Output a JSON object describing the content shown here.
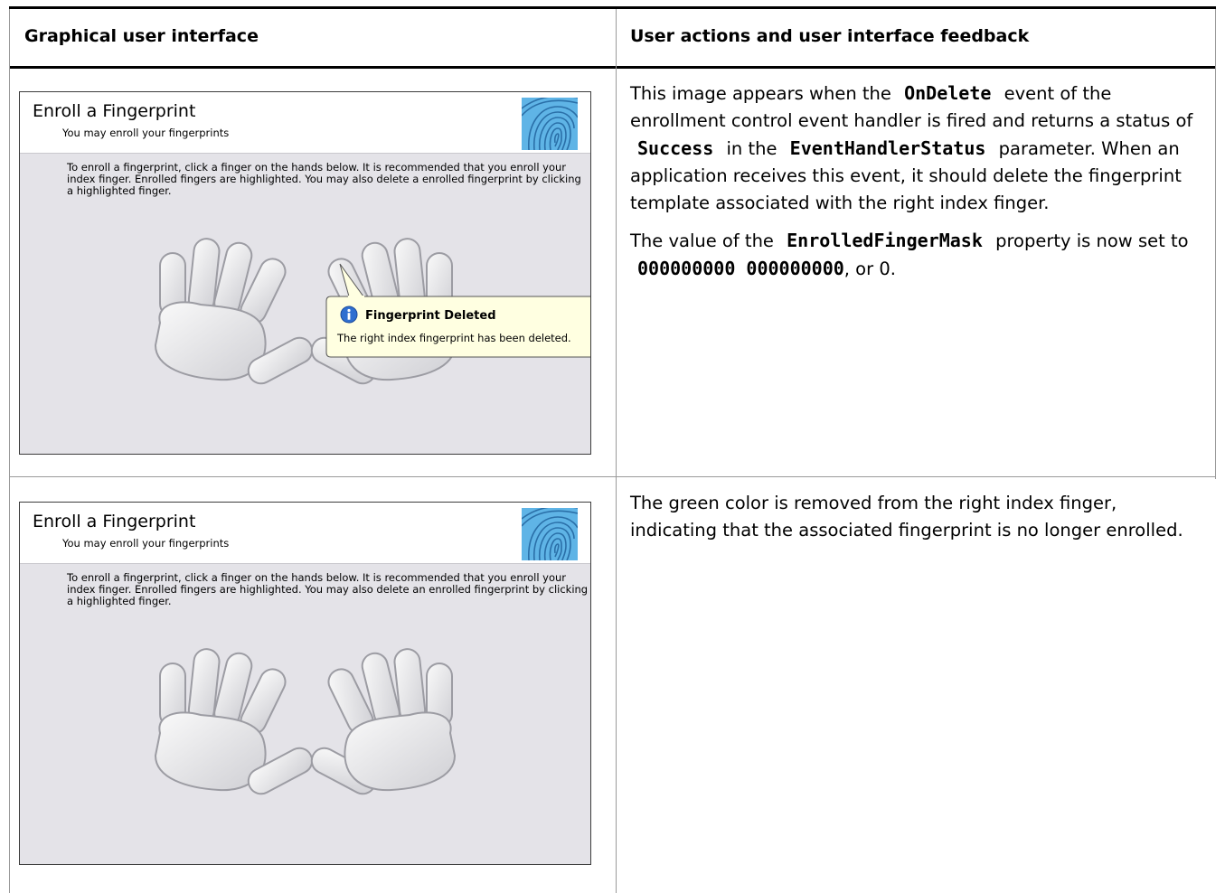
{
  "table": {
    "header_left": "Graphical user interface",
    "header_right": "User actions and user interface feedback"
  },
  "rows": [
    {
      "screenshot": {
        "title": "Enroll a Fingerprint",
        "subtitle": "You may enroll your fingerprints",
        "instructions": "To enroll a fingerprint, click a finger on the hands below. It is recommended that you enroll your index finger. Enrolled fingers are highlighted. You may also delete a enrolled fingerprint by clicking a highlighted finger.",
        "balloon_title": "Fingerprint Deleted",
        "balloon_text": "The right index fingerprint has been deleted.",
        "balloon_icon": "info-icon"
      },
      "feedback": {
        "p1_a": "This image appears when the",
        "p1_code1": "OnDelete",
        "p1_b": "event of the enrollment control event handler is fired and returns a status of",
        "p1_code2": "Success",
        "p1_c": "in the",
        "p1_code3": "EventHandlerStatus",
        "p1_d": "parameter. When an application receives this event, it should delete the fingerprint template associated with the right index finger.",
        "p2_a": "The value of the",
        "p2_code1": "EnrolledFingerMask",
        "p2_b": "property is now set to",
        "p2_code2": "000000000 000000000",
        "p2_c": ", or 0."
      }
    },
    {
      "screenshot": {
        "title": "Enroll a Fingerprint",
        "subtitle": "You may enroll your fingerprints",
        "instructions": "To enroll a fingerprint, click a finger on the hands below. It is recommended that you enroll your index finger. Enrolled fingers are highlighted. You may also delete an enrolled fingerprint by clicking a highlighted finger."
      },
      "feedback": {
        "p1": "The green color is removed from the right index finger, indicating that the associated fingerprint is no longer enrolled."
      }
    }
  ]
}
